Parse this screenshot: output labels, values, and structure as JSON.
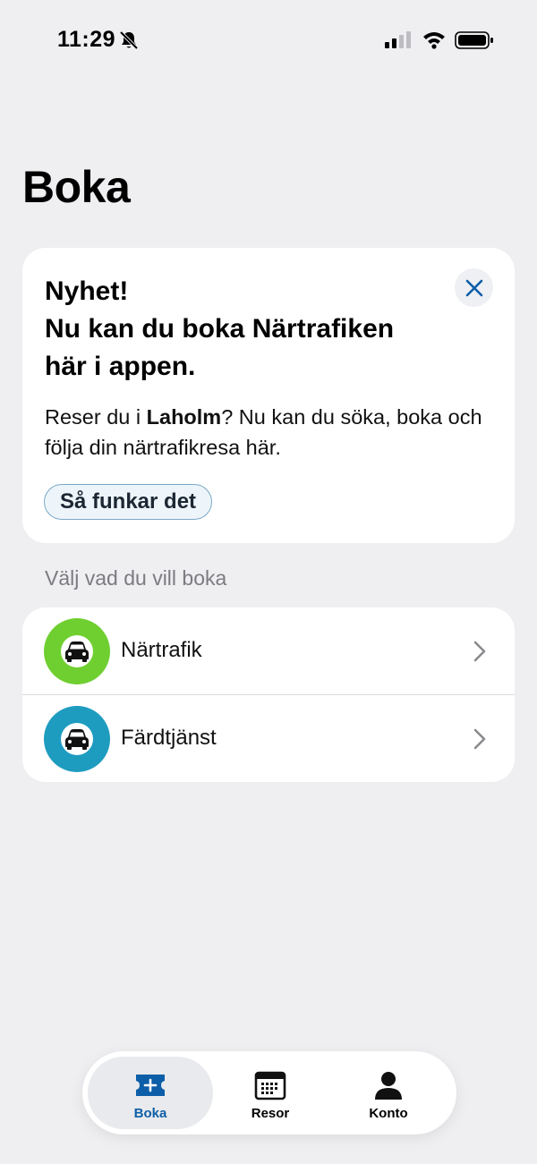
{
  "status_bar": {
    "time": "11:29"
  },
  "page": {
    "title": "Boka"
  },
  "promo": {
    "heading_line1": "Nyhet!",
    "heading_line2": "Nu kan du boka Närtrafiken",
    "heading_line3": "här i appen.",
    "body_prefix": "Reser du i ",
    "body_bold": "Laholm",
    "body_suffix": "? Nu kan du söka, boka och följa din närtrafikresa här.",
    "button_label": "Så funkar det"
  },
  "section": {
    "label": "Välj vad du vill boka"
  },
  "options": [
    {
      "label": "Närtrafik",
      "color": "#6fcf30",
      "icon": "car-icon"
    },
    {
      "label": "Färdtjänst",
      "color": "#1e9cc0",
      "icon": "car-icon"
    }
  ],
  "tabs": [
    {
      "label": "Boka",
      "icon": "ticket-plus-icon",
      "active": true
    },
    {
      "label": "Resor",
      "icon": "calendar-icon",
      "active": false
    },
    {
      "label": "Konto",
      "icon": "person-icon",
      "active": false
    }
  ],
  "colors": {
    "accent": "#0d5ea8",
    "background": "#efeff2"
  }
}
